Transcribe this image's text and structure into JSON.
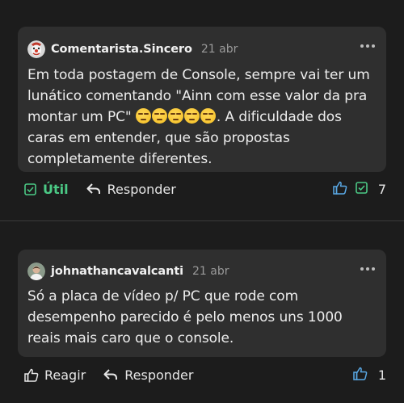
{
  "comments": [
    {
      "username": "Comentarista.Sincero",
      "date": "21 abr",
      "text_before_emoji": "Em toda postagem de Console, sempre vai ter um lunático comentando \"Ainn com esse valor da pra montar um PC\" ",
      "emoji_count": 5,
      "emoji_name": "expressionless-face",
      "text_after_emoji": ". A dificuldade dos caras em entender, que são propostas completamente diferentes.",
      "actions": {
        "useful_label": "Útil",
        "reply_label": "Responder",
        "count": "7"
      }
    },
    {
      "username": "johnathancavalcanti",
      "date": "21 abr",
      "text": "Só a placa de vídeo p/ PC que rode com desempenho parecido é pelo menos uns 1000 reais mais caro que o console.",
      "actions": {
        "react_label": "Reagir",
        "reply_label": "Responder",
        "count": "1"
      }
    }
  ],
  "colors": {
    "background": "#1c1c1c",
    "card": "#2f2f2f",
    "useful_green": "#4bc985",
    "like_blue": "#5aa9e6"
  }
}
